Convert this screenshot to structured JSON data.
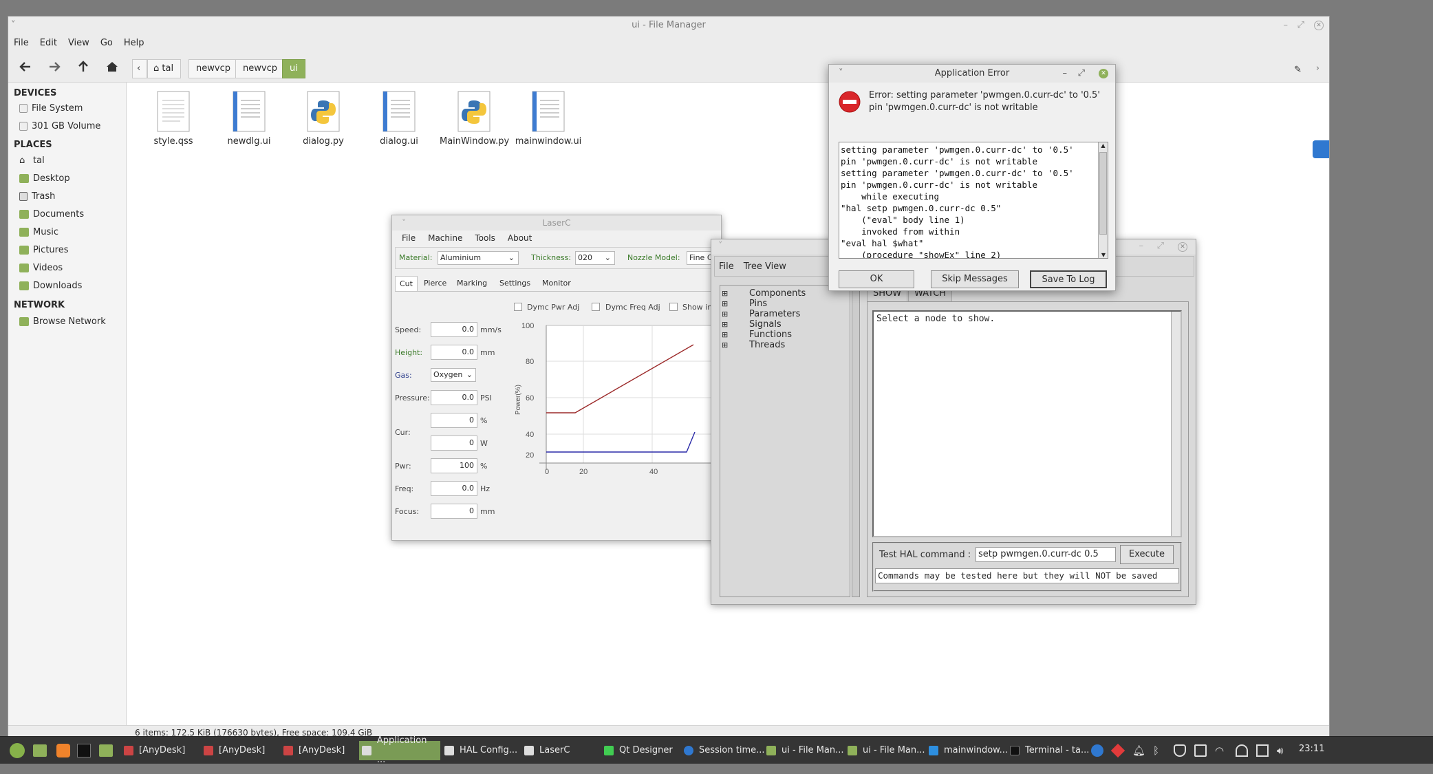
{
  "file_manager": {
    "title": "ui - File Manager",
    "menu": [
      "File",
      "Edit",
      "View",
      "Go",
      "Help"
    ],
    "breadcrumbs": [
      "tal",
      "newvcp",
      "newvcp",
      "ui"
    ],
    "sidebar": {
      "devices_header": "DEVICES",
      "devices": [
        "File System",
        "301 GB Volume"
      ],
      "places_header": "PLACES",
      "places": [
        "tal",
        "Desktop",
        "Trash",
        "Documents",
        "Music",
        "Pictures",
        "Videos",
        "Downloads"
      ],
      "network_header": "NETWORK",
      "network": [
        "Browse Network"
      ]
    },
    "files": [
      {
        "name": "style.qss",
        "icon": "text-file-icon"
      },
      {
        "name": "newdlg.ui",
        "icon": "ui-file-icon"
      },
      {
        "name": "dialog.py",
        "icon": "python-file-icon"
      },
      {
        "name": "dialog.ui",
        "icon": "ui-file-icon"
      },
      {
        "name": "MainWindow.py",
        "icon": "python-file-icon"
      },
      {
        "name": "mainwindow.ui",
        "icon": "ui-file-icon"
      }
    ],
    "status": "6 items: 172.5 KiB (176630 bytes), Free space: 109.4 GiB"
  },
  "laserc": {
    "title": "LaserC",
    "menu": [
      "File",
      "Machine",
      "Tools",
      "About"
    ],
    "material_label": "Material:",
    "material_value": "Aluminium",
    "thickness_label": "Thickness:",
    "thickness_value": "020",
    "nozzle_label": "Nozzle Model:",
    "nozzle_value": "Fine C",
    "tabs": [
      "Cut",
      "Pierce",
      "Marking",
      "Settings",
      "Monitor"
    ],
    "checkboxes": [
      "Dymc Pwr Adj",
      "Dymc Freq Adj",
      "Show in"
    ],
    "fields": {
      "speed_label": "Speed:",
      "speed_value": "0.0",
      "speed_unit": "mm/s",
      "height_label": "Height:",
      "height_value": "0.0",
      "height_unit": "mm",
      "gas_label": "Gas:",
      "gas_value": "Oxygen",
      "pressure_label": "Pressure:",
      "pressure_value": "0.0",
      "pressure_unit": "PSI",
      "pct_value": "0",
      "pct_unit": "%",
      "cur_label": "Cur:",
      "cur_value": "0",
      "cur_unit": "W",
      "pwr_label": "Pwr:",
      "pwr_value": "100",
      "pwr_unit": "%",
      "freq_label": "Freq:",
      "freq_value": "0.0",
      "freq_unit": "Hz",
      "focus_label": "Focus:",
      "focus_value": "0",
      "focus_unit": "mm"
    },
    "chart_ylabel": "Power(%)",
    "chart_yticks": [
      "100",
      "80",
      "60",
      "40",
      "20"
    ],
    "chart_xticks": [
      "0",
      "20",
      "40"
    ]
  },
  "hal_config": {
    "menu": [
      "File",
      "Tree View"
    ],
    "tree": [
      "Components",
      "Pins",
      "Parameters",
      "Signals",
      "Functions",
      "Threads"
    ],
    "tabs": [
      "SHOW",
      "WATCH"
    ],
    "show_text": "Select a node to show.",
    "cmd_label": "Test HAL command :",
    "cmd_value": "setp pwmgen.0.curr-dc 0.5",
    "execute_label": "Execute",
    "note": "Commands may be tested here but they will NOT be saved"
  },
  "error_dialog": {
    "title": "Application Error",
    "message_line1": "Error: setting parameter 'pwmgen.0.curr-dc' to '0.5'",
    "message_line2": "pin 'pwmgen.0.curr-dc' is not writable",
    "log": "setting parameter 'pwmgen.0.curr-dc' to '0.5'\npin 'pwmgen.0.curr-dc' is not writable\nsetting parameter 'pwmgen.0.curr-dc' to '0.5'\npin 'pwmgen.0.curr-dc' is not writable\n    while executing\n\"hal setp pwmgen.0.curr-dc 0.5\"\n    (\"eval\" body line 1)\n    invoked from within\n\"eval hal $what\"\n    (procedure \"showEx\" line 2)",
    "ok_label": "OK",
    "skip_label": "Skip Messages",
    "save_label": "Save To Log"
  },
  "taskbar": {
    "tasks": [
      "[AnyDesk]",
      "[AnyDesk]",
      "[AnyDesk]",
      "Application ...",
      "HAL Config...",
      "LaserC",
      "Qt Designer",
      "Session time...",
      "ui - File Man...",
      "ui - File Man...",
      "mainwindow...",
      "Terminal - ta..."
    ],
    "clock": "23:11"
  }
}
